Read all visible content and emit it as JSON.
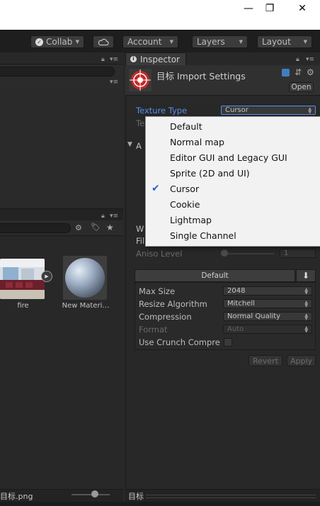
{
  "window": {
    "minimize": "—",
    "maximize": "❐",
    "close": "✕"
  },
  "toolbar": {
    "collab": "Collab",
    "account": "Account",
    "layers": "Layers",
    "layout": "Layout"
  },
  "project": {
    "items": [
      {
        "label": "fire"
      },
      {
        "label": "New Materi…"
      }
    ],
    "footer_label": "目标.png"
  },
  "inspector": {
    "tab_label": "Inspector",
    "title": "目标 Import Settings",
    "open_button": "Open",
    "texture_type_label": "Texture Type",
    "texture_type_value": "Cursor",
    "hidden_label_te": "Te",
    "hidden_label_a": "A",
    "wrap_label_partial": "W",
    "filter_label_partial": "Fil",
    "aniso_label": "Aniso Level",
    "aniso_value": "1",
    "aniso_fraction": 0.0,
    "platform_tab": "Default",
    "max_size_label": "Max Size",
    "max_size_value": "2048",
    "resize_label": "Resize Algorithm",
    "resize_value": "Mitchell",
    "compression_label": "Compression",
    "compression_value": "Normal Quality",
    "format_label": "Format",
    "format_value": "Auto",
    "crunch_label": "Use Crunch Compre",
    "revert_button": "Revert",
    "apply_button": "Apply",
    "footer_label": "目标"
  },
  "texture_type_menu": {
    "options": [
      "Default",
      "Normal map",
      "Editor GUI and Legacy GUI",
      "Sprite (2D and UI)",
      "Cursor",
      "Cookie",
      "Lightmap",
      "Single Channel"
    ],
    "selected": "Cursor"
  },
  "colors": {
    "accent_blue": "#5b8ee6",
    "menu_bg": "#f2f2f2",
    "check": "#2a65c9",
    "panel_bg": "#282828"
  }
}
